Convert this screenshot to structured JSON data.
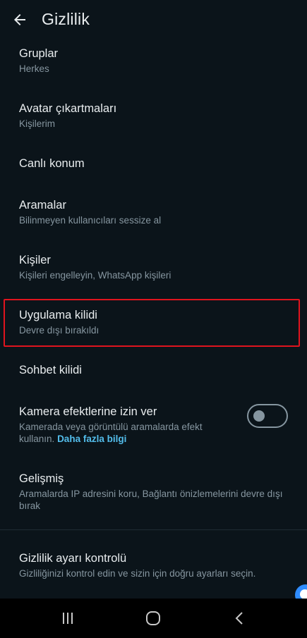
{
  "header": {
    "title": "Gizlilik",
    "back_icon": "arrow-left-icon"
  },
  "items": [
    {
      "label": "Gruplar",
      "sub": "Herkes"
    },
    {
      "label": "Avatar çıkartmaları",
      "sub": "Kişilerim"
    },
    {
      "label": "Canlı konum"
    },
    {
      "label": "Aramalar",
      "sub": "Bilinmeyen kullanıcıları sessize al"
    },
    {
      "label": "Kişiler",
      "sub": "Kişileri engelleyin, WhatsApp kişileri"
    },
    {
      "label": "Uygulama kilidi",
      "sub": "Devre dışı bırakıldı"
    },
    {
      "label": "Sohbet kilidi"
    },
    {
      "label": "Kamera efektlerine izin ver",
      "sub": "Kamerada veya görüntülü aramalarda efekt kullanın.",
      "link": "Daha fazla bilgi",
      "toggle_on": false
    },
    {
      "label": "Gelişmiş",
      "sub": "Aramalarda IP adresini koru, Bağlantı önizlemelerini devre dışı bırak"
    },
    {
      "label": "Gizlilik ayarı kontrolü",
      "sub": "Gizliliğinizi kontrol edin ve sizin için doğru ayarları seçin."
    }
  ],
  "navbar": {
    "recents_icon": "recents-icon",
    "home_icon": "home-icon",
    "back_icon": "back-chevron-icon"
  },
  "colors": {
    "background": "#0b141a",
    "primary_text": "#e9edef",
    "secondary_text": "#8696a0",
    "link": "#53bdeb",
    "highlight": "#e0141e"
  }
}
